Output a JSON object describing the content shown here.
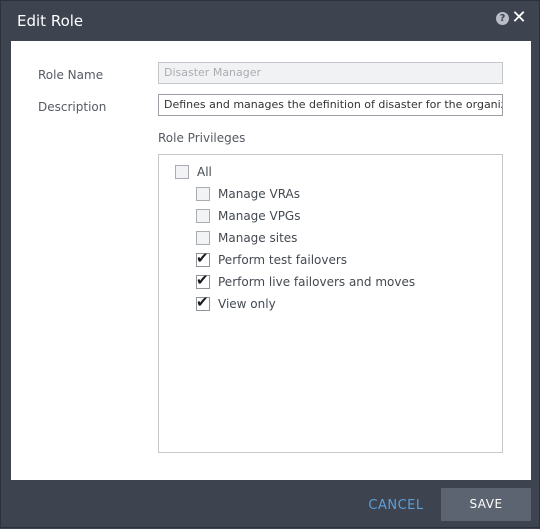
{
  "dialog": {
    "title": "Edit Role",
    "help_icon_glyph": "?",
    "close_icon_glyph": "✕"
  },
  "form": {
    "role_name_label": "Role Name",
    "role_name_value": "Disaster Manager",
    "description_label": "Description",
    "description_value": "Defines and manages the definition of disaster for the organization",
    "privileges_label": "Role Privileges"
  },
  "privileges": [
    {
      "label": "All",
      "checked": false
    },
    {
      "label": "Manage VRAs",
      "checked": false
    },
    {
      "label": "Manage VPGs",
      "checked": false
    },
    {
      "label": "Manage sites",
      "checked": false
    },
    {
      "label": "Perform test failovers",
      "checked": true
    },
    {
      "label": "Perform live failovers and moves",
      "checked": true
    },
    {
      "label": "View only",
      "checked": true
    }
  ],
  "footer": {
    "cancel_label": "CANCEL",
    "save_label": "SAVE"
  },
  "colors": {
    "chrome": "#3d4450",
    "accent_link": "#5e9fd8",
    "save_button": "#5d6471"
  }
}
